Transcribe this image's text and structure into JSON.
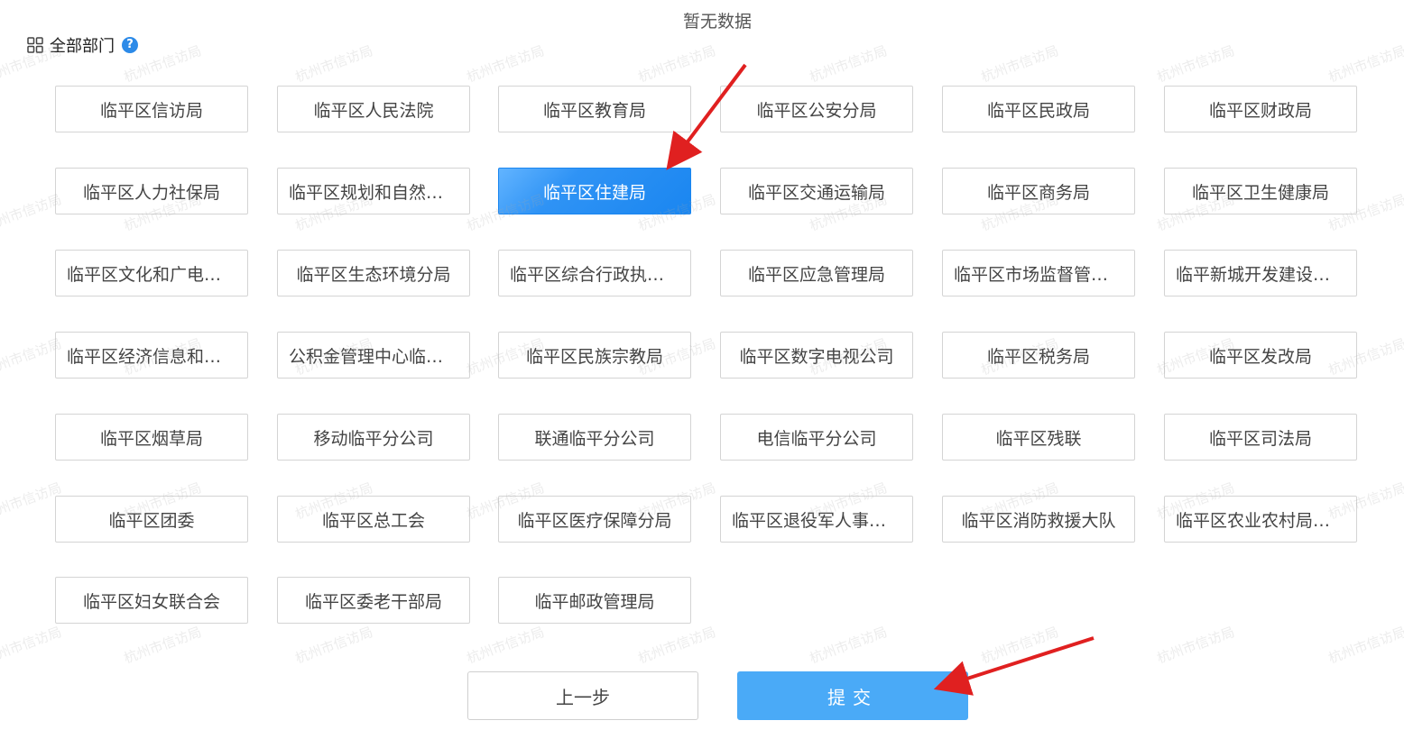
{
  "no_data_text": "暂无数据",
  "section": {
    "title": "全部部门",
    "help_icon": "?"
  },
  "departments": [
    {
      "label": "临平区信访局",
      "selected": false
    },
    {
      "label": "临平区人民法院",
      "selected": false
    },
    {
      "label": "临平区教育局",
      "selected": false
    },
    {
      "label": "临平区公安分局",
      "selected": false
    },
    {
      "label": "临平区民政局",
      "selected": false
    },
    {
      "label": "临平区财政局",
      "selected": false
    },
    {
      "label": "临平区人力社保局",
      "selected": false
    },
    {
      "label": "临平区规划和自然资...",
      "selected": false
    },
    {
      "label": "临平区住建局",
      "selected": true
    },
    {
      "label": "临平区交通运输局",
      "selected": false
    },
    {
      "label": "临平区商务局",
      "selected": false
    },
    {
      "label": "临平区卫生健康局",
      "selected": false
    },
    {
      "label": "临平区文化和广电旅...",
      "selected": false
    },
    {
      "label": "临平区生态环境分局",
      "selected": false
    },
    {
      "label": "临平区综合行政执法局",
      "selected": false
    },
    {
      "label": "临平区应急管理局",
      "selected": false
    },
    {
      "label": "临平区市场监督管理局",
      "selected": false
    },
    {
      "label": "临平新城开发建设管...",
      "selected": false
    },
    {
      "label": "临平区经济信息和科...",
      "selected": false
    },
    {
      "label": "公积金管理中心临平...",
      "selected": false
    },
    {
      "label": "临平区民族宗教局",
      "selected": false
    },
    {
      "label": "临平区数字电视公司",
      "selected": false
    },
    {
      "label": "临平区税务局",
      "selected": false
    },
    {
      "label": "临平区发改局",
      "selected": false
    },
    {
      "label": "临平区烟草局",
      "selected": false
    },
    {
      "label": "移动临平分公司",
      "selected": false
    },
    {
      "label": "联通临平分公司",
      "selected": false
    },
    {
      "label": "电信临平分公司",
      "selected": false
    },
    {
      "label": "临平区残联",
      "selected": false
    },
    {
      "label": "临平区司法局",
      "selected": false
    },
    {
      "label": "临平区团委",
      "selected": false
    },
    {
      "label": "临平区总工会",
      "selected": false
    },
    {
      "label": "临平区医疗保障分局",
      "selected": false
    },
    {
      "label": "临平区退役军人事务局",
      "selected": false
    },
    {
      "label": "临平区消防救援大队",
      "selected": false
    },
    {
      "label": "临平区农业农村局（...",
      "selected": false
    },
    {
      "label": "临平区妇女联合会",
      "selected": false
    },
    {
      "label": "临平区委老干部局",
      "selected": false
    },
    {
      "label": "临平邮政管理局",
      "selected": false
    }
  ],
  "footer": {
    "prev_label": "上一步",
    "submit_label": "提交"
  },
  "watermark_text": "杭州市信访局",
  "colors": {
    "selected_bg": "#1a86f0",
    "submit_bg": "#4aaaf7",
    "annotation_arrow": "#e02020",
    "help_icon_bg": "#2c8ae8"
  },
  "icons": {
    "section_icon": "grid-icon",
    "help": "help-icon"
  }
}
